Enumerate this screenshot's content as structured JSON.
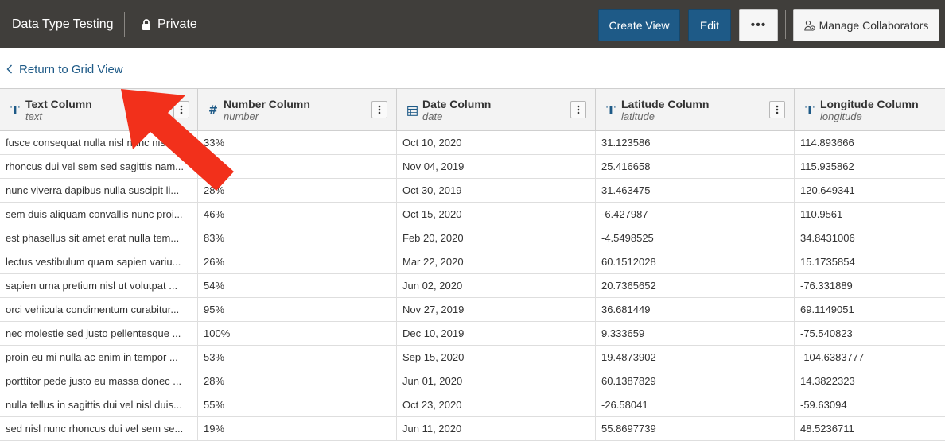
{
  "header": {
    "title": "Data Type Testing",
    "privacy_label": "Private",
    "create_view_label": "Create View",
    "edit_label": "Edit",
    "more_label": "•••",
    "manage_collaborators_label": "Manage Collaborators"
  },
  "nav": {
    "back_label": "Return to Grid View"
  },
  "columns": [
    {
      "name": "Text Column",
      "field": "text",
      "type_icon": "text-type-icon"
    },
    {
      "name": "Number Column",
      "field": "number",
      "type_icon": "number-type-icon"
    },
    {
      "name": "Date Column",
      "field": "date",
      "type_icon": "calendar-icon"
    },
    {
      "name": "Latitude Column",
      "field": "latitude",
      "type_icon": "text-type-icon"
    },
    {
      "name": "Longitude Column",
      "field": "longitude",
      "type_icon": "text-type-icon"
    }
  ],
  "rows": [
    [
      "fusce consequat nulla nisl nunc nisl ...",
      "33%",
      "Oct 10, 2020",
      "31.123586",
      "114.893666"
    ],
    [
      "rhoncus dui vel sem sed sagittis nam...",
      "2",
      "Nov 04, 2019",
      "25.416658",
      "115.935862"
    ],
    [
      "nunc viverra dapibus nulla suscipit li...",
      "28%",
      "Oct 30, 2019",
      "31.463475",
      "120.649341"
    ],
    [
      "sem duis aliquam convallis nunc proi...",
      "46%",
      "Oct 15, 2020",
      "-6.427987",
      "110.9561"
    ],
    [
      "est phasellus sit amet erat nulla tem...",
      "83%",
      "Feb 20, 2020",
      "-4.5498525",
      "34.8431006"
    ],
    [
      "lectus vestibulum quam sapien variu...",
      "26%",
      "Mar 22, 2020",
      "60.1512028",
      "15.1735854"
    ],
    [
      "sapien urna pretium nisl ut volutpat ...",
      "54%",
      "Jun 02, 2020",
      "20.7365652",
      "-76.331889"
    ],
    [
      "orci vehicula condimentum curabitur...",
      "95%",
      "Nov 27, 2019",
      "36.681449",
      "69.1149051"
    ],
    [
      "nec molestie sed justo pellentesque ...",
      "100%",
      "Dec 10, 2019",
      "9.333659",
      "-75.540823"
    ],
    [
      "proin eu mi nulla ac enim in tempor ...",
      "53%",
      "Sep 15, 2020",
      "19.4873902",
      "-104.6383777"
    ],
    [
      "porttitor pede justo eu massa donec ...",
      "28%",
      "Jun 01, 2020",
      "60.1387829",
      "14.3822323"
    ],
    [
      "nulla tellus in sagittis dui vel nisl duis...",
      "55%",
      "Oct 23, 2020",
      "-26.58041",
      "-59.63094"
    ],
    [
      "sed nisl nunc rhoncus dui vel sem se...",
      "19%",
      "Jun 11, 2020",
      "55.8697739",
      "48.5236711"
    ]
  ],
  "colors": {
    "topbar": "#403e3b",
    "primary": "#1e5a87",
    "annotation_arrow": "#f2301b"
  }
}
